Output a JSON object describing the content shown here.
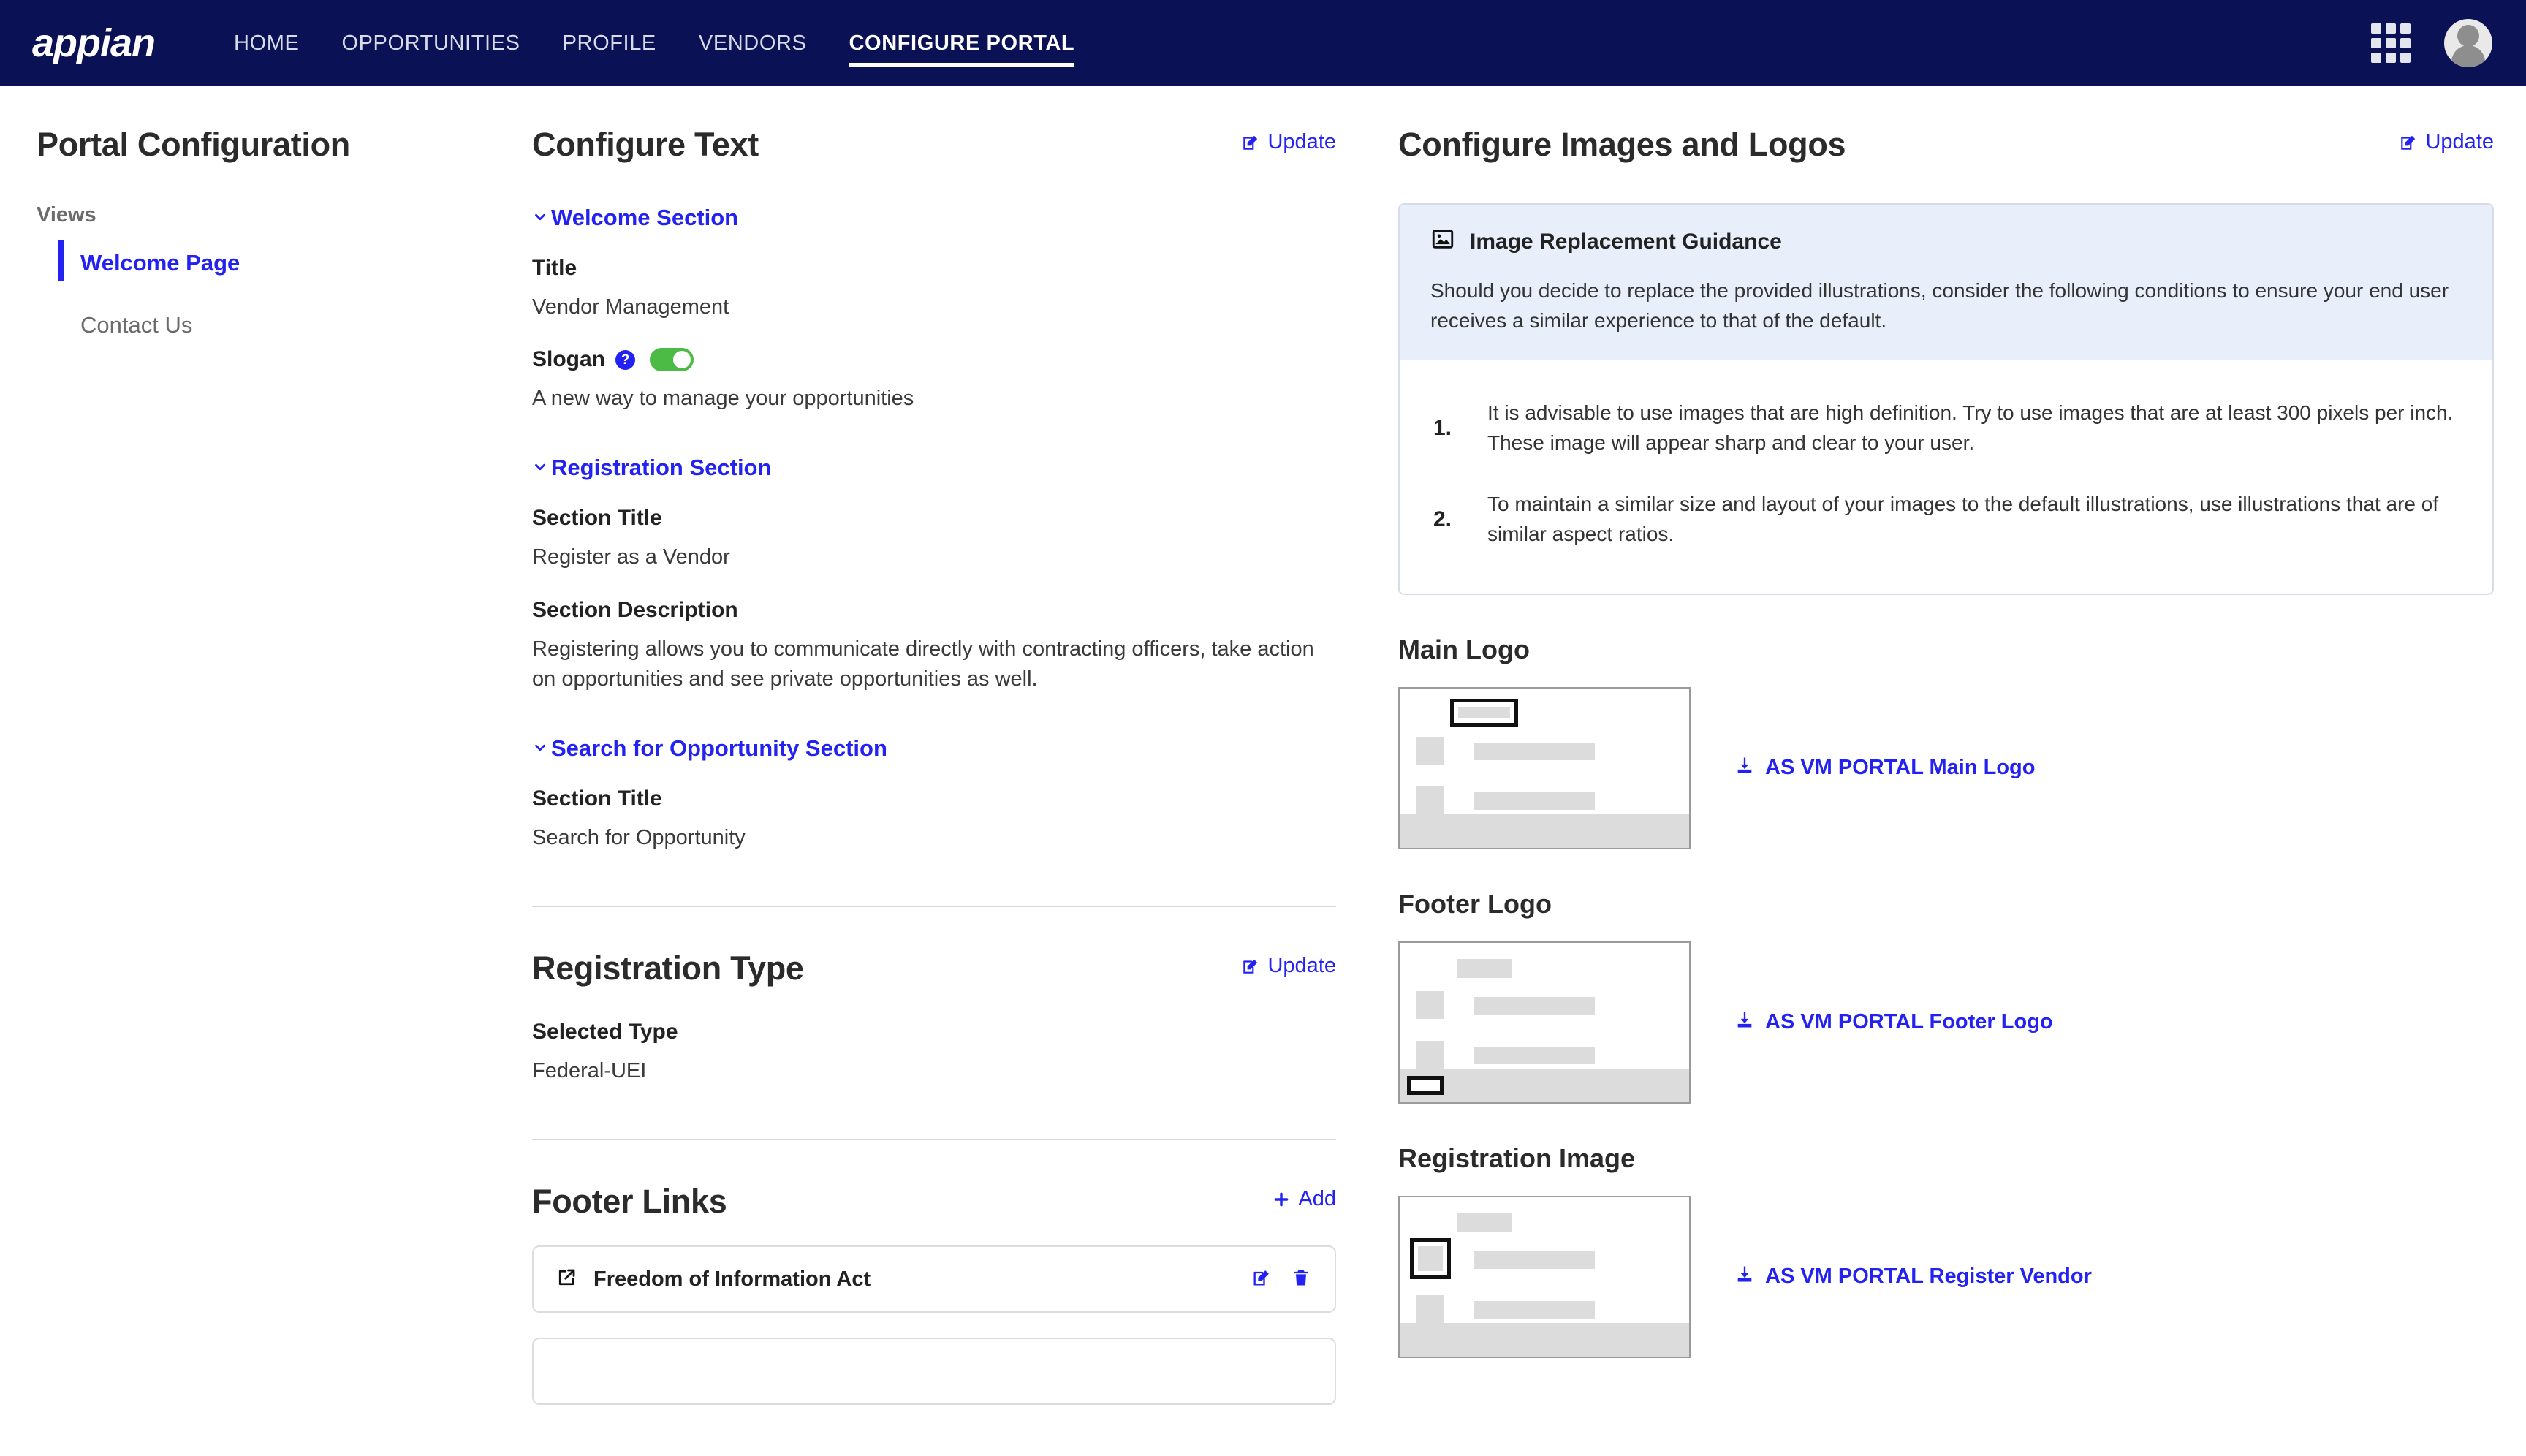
{
  "header": {
    "brand": "appian",
    "nav": [
      {
        "label": "HOME",
        "active": false
      },
      {
        "label": "OPPORTUNITIES",
        "active": false
      },
      {
        "label": "PROFILE",
        "active": false
      },
      {
        "label": "VENDORS",
        "active": false
      },
      {
        "label": "CONFIGURE PORTAL",
        "active": true
      }
    ],
    "grid_icon": "apps-grid-icon",
    "avatar": "user-avatar"
  },
  "sidebar": {
    "page_title": "Portal Configuration",
    "views_label": "Views",
    "items": [
      {
        "label": "Welcome Page",
        "active": true
      },
      {
        "label": "Contact Us",
        "active": false
      }
    ]
  },
  "configure_text": {
    "title": "Configure Text",
    "update_label": "Update",
    "sections": [
      {
        "name": "Welcome Section",
        "fields": [
          {
            "label": "Title",
            "value": "Vendor Management",
            "has_help": false,
            "has_toggle": false
          },
          {
            "label": "Slogan",
            "value": "A new way to manage your opportunities",
            "has_help": true,
            "help_glyph": "?",
            "has_toggle": true,
            "toggle_on": true
          }
        ]
      },
      {
        "name": "Registration Section",
        "fields": [
          {
            "label": "Section Title",
            "value": "Register as a Vendor",
            "has_help": false,
            "has_toggle": false
          },
          {
            "label": "Section Description",
            "value": "Registering allows you to communicate directly with contracting officers, take action on opportunities and see private opportunities as well.",
            "has_help": false,
            "has_toggle": false
          }
        ]
      },
      {
        "name": "Search for Opportunity Section",
        "fields": [
          {
            "label": "Section Title",
            "value": "Search for Opportunity",
            "has_help": false,
            "has_toggle": false
          }
        ]
      }
    ]
  },
  "registration_type": {
    "title": "Registration Type",
    "update_label": "Update",
    "field_label": "Selected Type",
    "field_value": "Federal-UEI"
  },
  "footer_links": {
    "title": "Footer Links",
    "add_label": "Add",
    "items": [
      {
        "label": "Freedom of Information Act",
        "link_icon": "external-link-icon",
        "edit_icon": "edit-icon",
        "delete_icon": "trash-icon"
      },
      {
        "label": "",
        "link_icon": "external-link-icon",
        "edit_icon": "edit-icon",
        "delete_icon": "trash-icon"
      }
    ]
  },
  "configure_images": {
    "title": "Configure Images and Logos",
    "update_label": "Update",
    "guidance": {
      "icon": "image-icon",
      "title": "Image Replacement Guidance",
      "intro": "Should you decide to replace the provided illustrations, consider the following conditions to ensure your end user receives a similar experience to that of the default.",
      "items": [
        {
          "num": "1.",
          "text": "It is advisable to use images that are high definition. Try to use images that are at least 300 pixels per inch. These image will appear sharp and clear to your user."
        },
        {
          "num": "2.",
          "text": "To maintain a similar size and layout of your images to the default illustrations, use illustrations that are of similar aspect ratios."
        }
      ]
    },
    "blocks": [
      {
        "title": "Main Logo",
        "download_label": "AS VM PORTAL Main Logo",
        "highlight": "header"
      },
      {
        "title": "Footer Logo",
        "download_label": "AS VM PORTAL Footer Logo",
        "highlight": "footer"
      },
      {
        "title": "Registration Image",
        "download_label": "AS VM PORTAL Register Vendor",
        "highlight": "left-block"
      }
    ]
  },
  "colors": {
    "nav_bg": "#0a1155",
    "accent": "#2322f0",
    "toggle_on": "#4cbb45",
    "guidance_bg": "#e9eefb"
  }
}
